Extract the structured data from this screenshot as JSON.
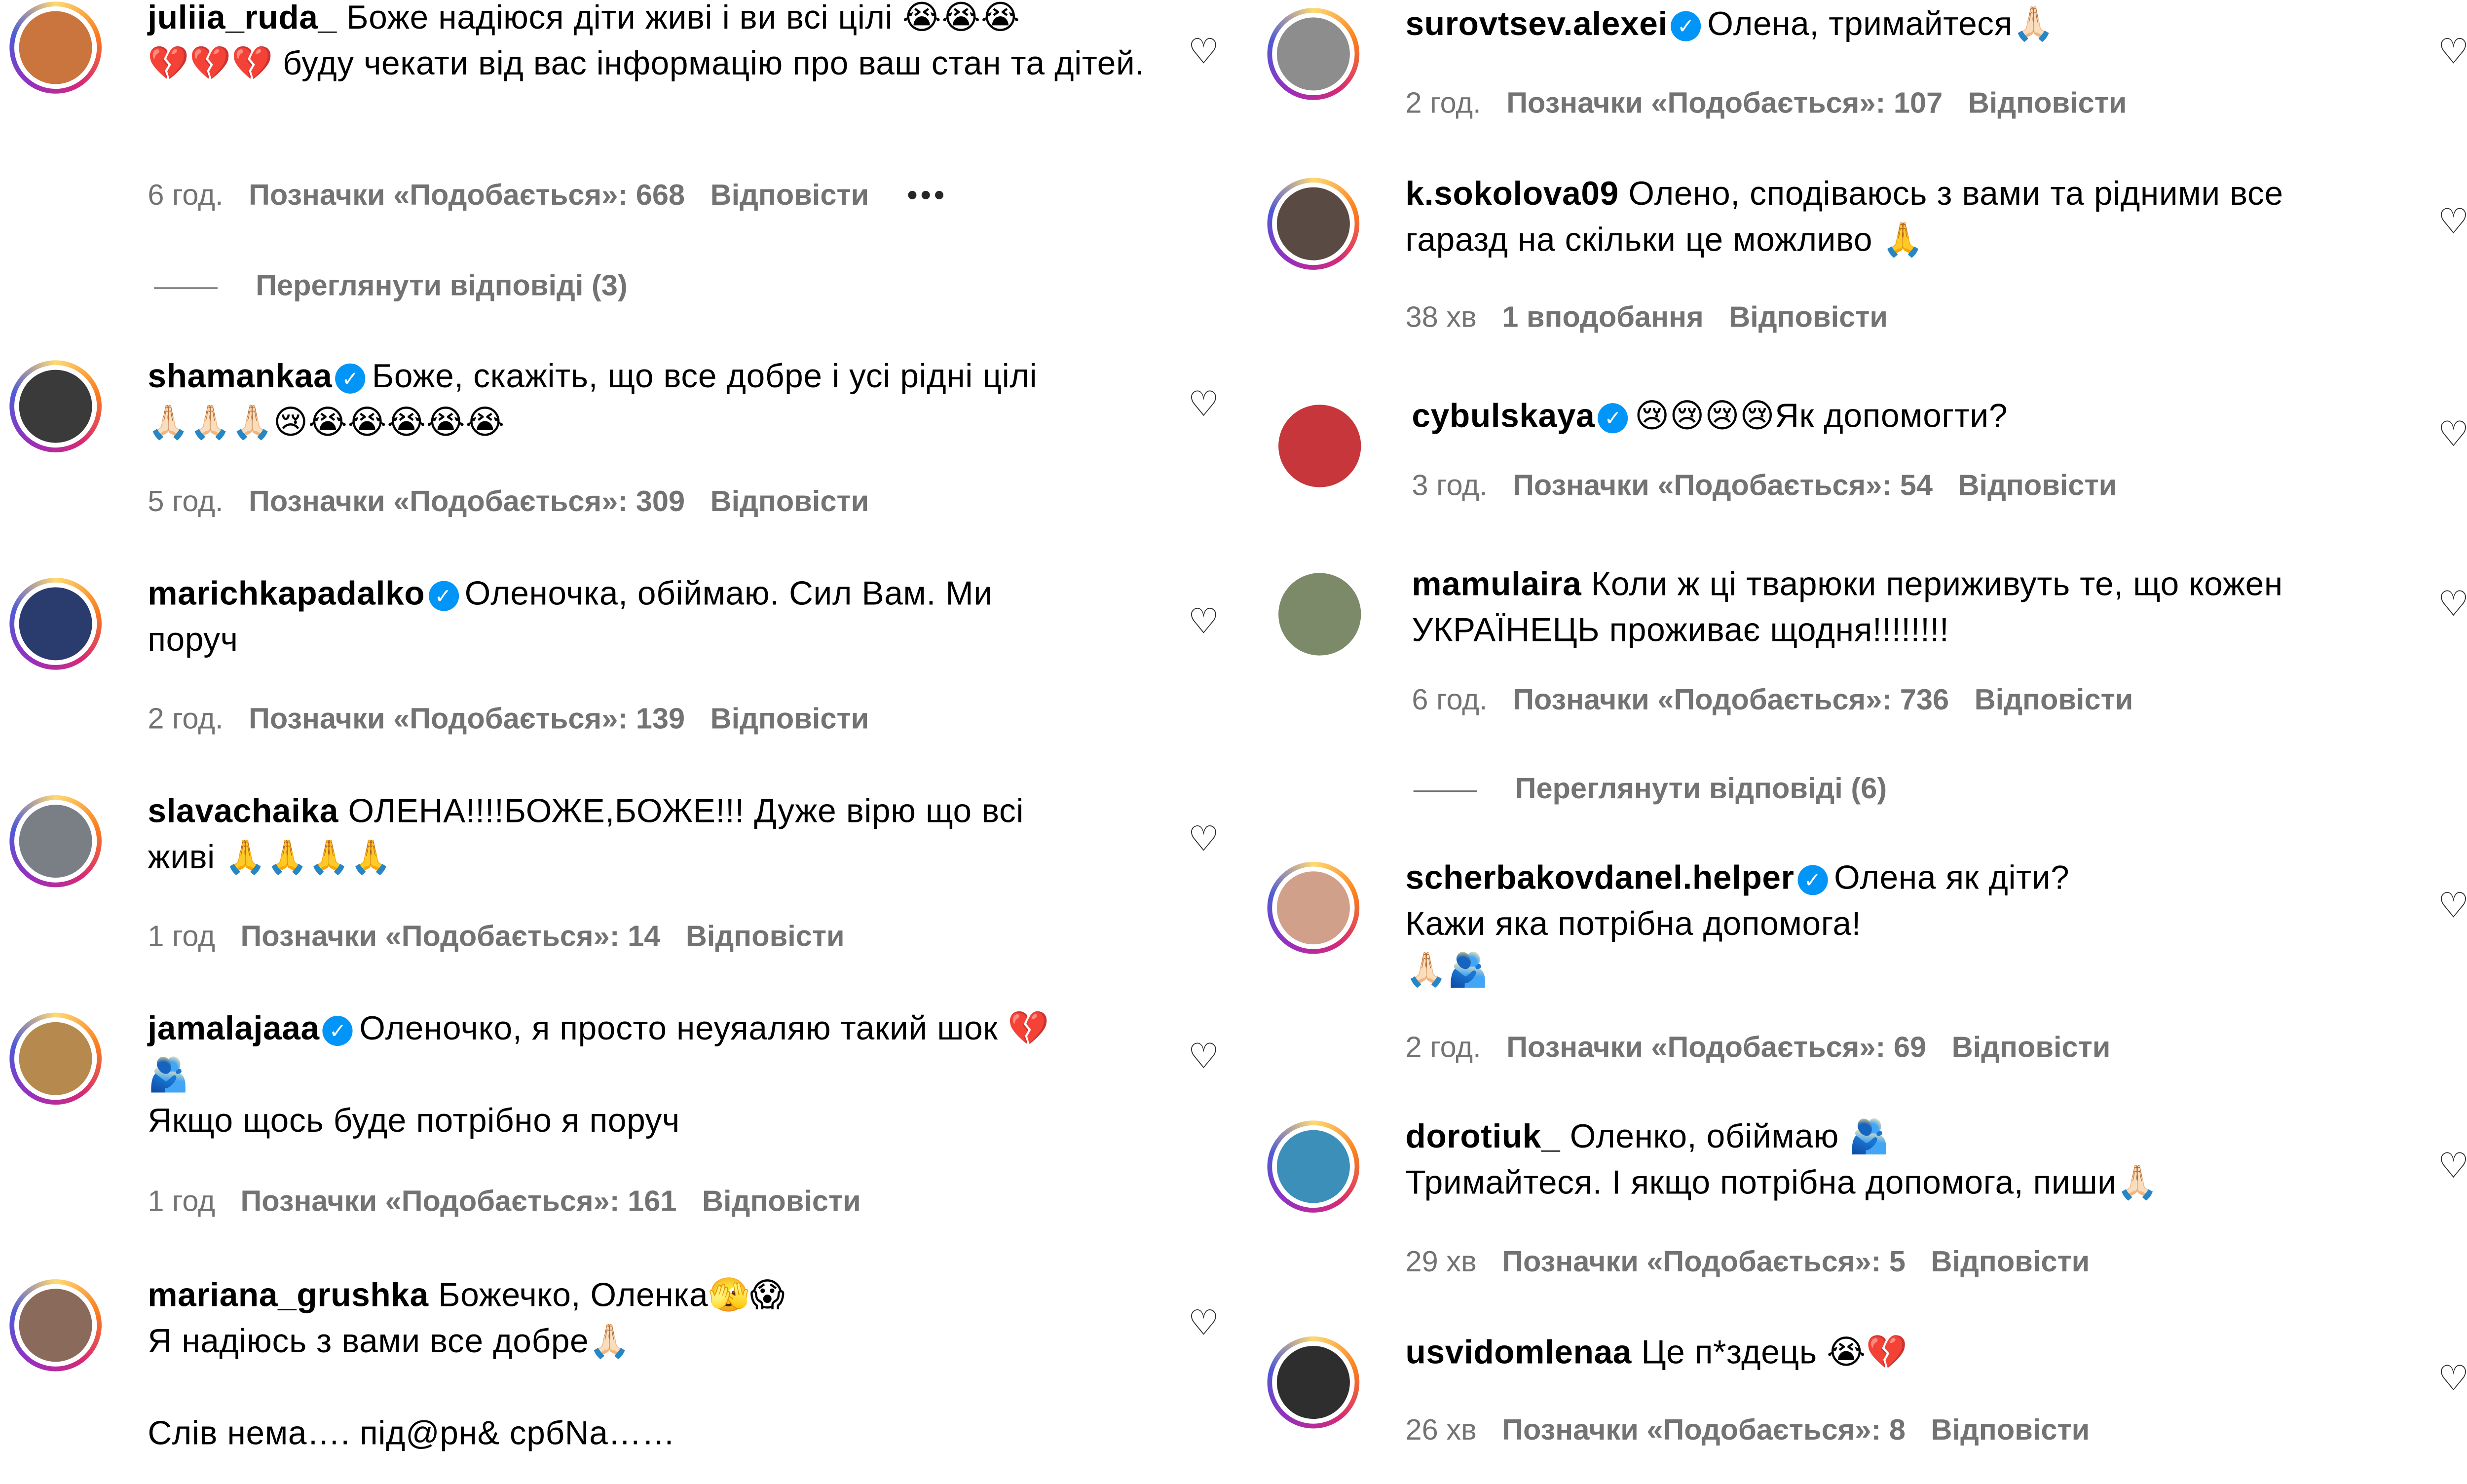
{
  "left": [
    {
      "user": "juliia_ruda_",
      "verified": false,
      "text": "Боже надіюся діти живі і ви всі цілі 😭😭😭\n💔💔💔 буду чекати від вас інформацію про ваш стан та дітей.",
      "time": "6 год.",
      "likes": "Позначки «Подобається»: 668",
      "reply": "Відповісти",
      "more": "•••",
      "view_replies": "Переглянути відповіді (3)",
      "avatar_color": "#c9753d"
    },
    {
      "user": "shamankaa",
      "verified": true,
      "text": "Боже, скажіть, що все добре і усі рідні цілі\n🙏🏻🙏🏻🙏🏻😢😭😭😭😭😭",
      "time": "5 год.",
      "likes": "Позначки «Подобається»: 309",
      "reply": "Відповісти",
      "avatar_color": "#3a3a3a"
    },
    {
      "user": "marichkapadalko",
      "verified": true,
      "text": "Оленочка, обіймаю. Сил Вам. Ми\nпоруч",
      "time": "2 год.",
      "likes": "Позначки «Подобається»: 139",
      "reply": "Відповісти",
      "avatar_color": "#2a3b6e"
    },
    {
      "user": "slavachaika",
      "verified": false,
      "text": "ОЛЕНА!!!!БОЖЕ,БОЖЕ!!! Дуже вірю що всі\nживі 🙏🙏🙏🙏",
      "time": "1 год",
      "likes": "Позначки «Подобається»: 14",
      "reply": "Відповісти",
      "avatar_color": "#7a7f86"
    },
    {
      "user": "jamalajaaa",
      "verified": true,
      "text": "Оленочко, я просто неуяаляю такий шок 💔\n🫂\nЯкщо щось буде потрібно я поруч",
      "time": "1 год",
      "likes": "Позначки «Подобається»: 161",
      "reply": "Відповісти",
      "avatar_color": "#b68a4e"
    },
    {
      "user": "mariana_grushka",
      "verified": false,
      "text": "Божечко, Оленка🫣😱\nЯ надіюсь з вами все добре🙏🏻\n\nСлів нема…. під@рн& србNa……",
      "time": "",
      "likes": "",
      "reply": "",
      "avatar_color": "#8a6a5a"
    }
  ],
  "right": [
    {
      "user": "surovtsev.alexei",
      "verified": true,
      "text": "Олена, тримайтеся🙏🏻",
      "time": "2 год.",
      "likes": "Позначки «Подобається»: 107",
      "reply": "Відповісти",
      "avatar_color": "#8d8d8d"
    },
    {
      "user": "k.sokolova09",
      "verified": false,
      "text": "Олено, сподіваюсь з вами та рідними все\nгаразд на скільки це можливо 🙏",
      "time": "38 хв",
      "likes": "1 вподобання",
      "reply": "Відповісти",
      "avatar_color": "#5a4a44"
    },
    {
      "user": "cybulskaya",
      "verified": true,
      "text": "😢😢😢😢Як допомогти?",
      "time": "3 год.",
      "likes": "Позначки «Подобається»: 54",
      "reply": "Відповісти",
      "avatar_color": "#c7363a"
    },
    {
      "user": "mamulaira",
      "verified": false,
      "text": "Коли ж ці тварюки периживуть те, що кожен\nУКРАЇНЕЦЬ проживає щодня!!!!!!!!",
      "time": "6 год.",
      "likes": "Позначки «Подобається»: 736",
      "reply": "Відповісти",
      "view_replies": "Переглянути відповіді (6)",
      "avatar_color": "#7d8a6a"
    },
    {
      "user": "scherbakovdanel.helper",
      "verified": true,
      "text": "Олена як діти?\nКажи яка потрібна допомога!\n🙏🏻🫂",
      "time": "2 год.",
      "likes": "Позначки «Подобається»: 69",
      "reply": "Відповісти",
      "avatar_color": "#d0a08a"
    },
    {
      "user": "dorotiuk_",
      "verified": false,
      "text": "Оленко, обіймаю 🫂\nТримайтеся. І якщо потрібна допомога, пиши🙏🏻",
      "time": "29 хв",
      "likes": "Позначки «Подобається»: 5",
      "reply": "Відповісти",
      "avatar_color": "#3b8fb8"
    },
    {
      "user": "usvidomlenaa",
      "verified": false,
      "text": "Це п*здець 😭💔",
      "time": "26 хв",
      "likes": "Позначки «Подобається»: 8",
      "reply": "Відповісти",
      "avatar_color": "#2e2e2e"
    }
  ],
  "icons": {
    "heart": "heart-icon",
    "verified": "verified-badge-icon",
    "more": "more-options-icon"
  }
}
